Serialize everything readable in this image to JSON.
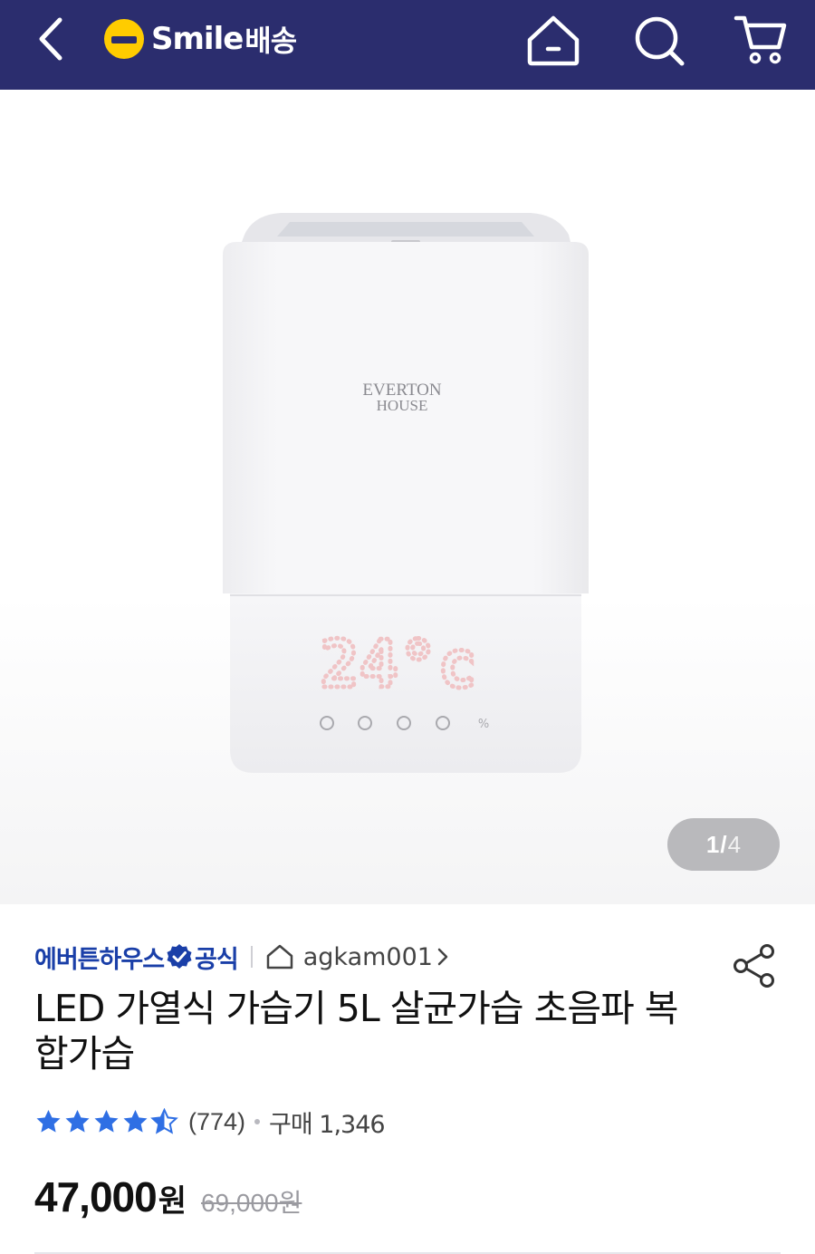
{
  "header": {
    "logo_text": "Smile",
    "logo_sub": "배송",
    "logo_color": "#ffcc00",
    "bg_color": "#2b2d6e",
    "icons": [
      "back-icon",
      "home-icon",
      "search-icon",
      "cart-icon"
    ]
  },
  "gallery": {
    "product_brand_print": "EVERTON HOUSE",
    "display_reading": "24°C",
    "current_page": "1",
    "total_pages": "4"
  },
  "seller": {
    "brand": "에버튼하우스",
    "official_label": "공식",
    "store_name": "agkam001",
    "accent_color": "#1a3fa8"
  },
  "product": {
    "title": "LED 가열식 가습기 5L 살균가습 초음파 복합가습"
  },
  "rating": {
    "stars": 4.5,
    "review_count": "(774)",
    "purchase": "구매 1,346",
    "star_color": "#2f6fe4"
  },
  "price": {
    "sale_value": "47,000",
    "unit": "원",
    "original": "69,000원"
  }
}
